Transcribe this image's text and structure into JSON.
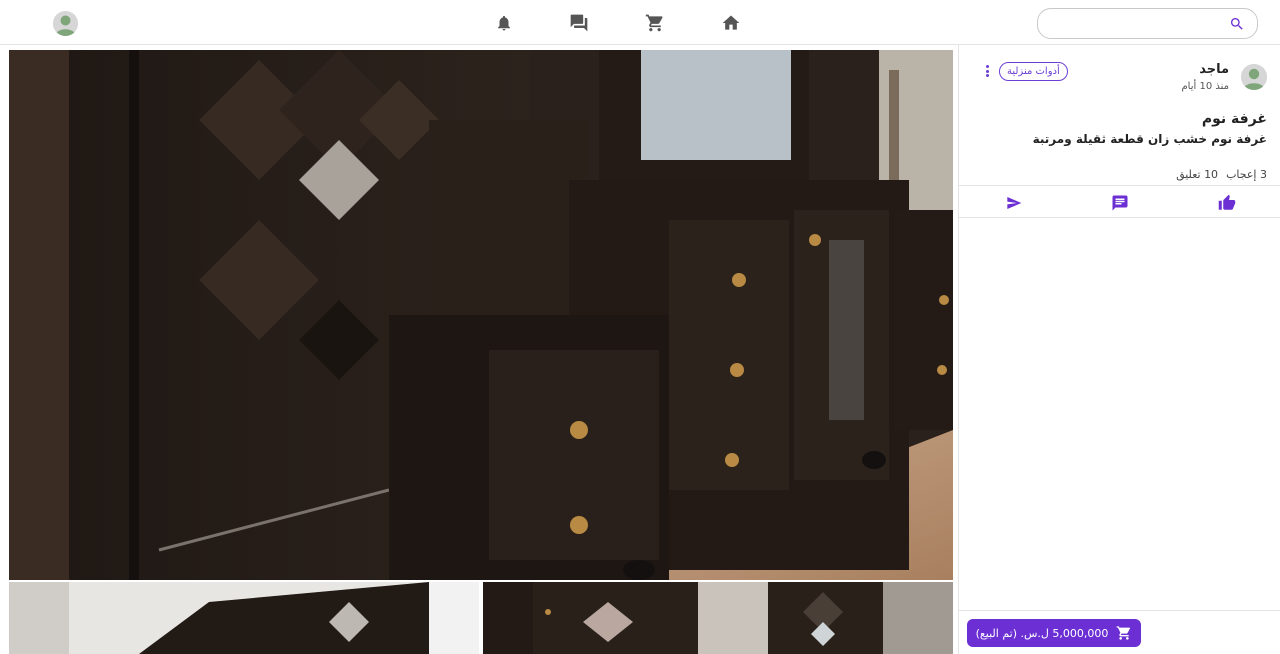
{
  "search": {
    "placeholder": "",
    "value": ""
  },
  "nav": {
    "icons": [
      "home-icon",
      "cart-icon",
      "chat-icon",
      "bell-icon",
      "avatar"
    ]
  },
  "post": {
    "author": "ماجد",
    "time": "منذ 10 أيام",
    "category": "أدوات منزلية",
    "title": "غرفة نوم",
    "description": "غرفة نوم خشب زان قطعة ثقيلة ومرتبة",
    "likes_label": "3 إعجاب",
    "comments_label": "10 تعليق",
    "price_label": "5,000,000 ل.س. (تم البيع)"
  },
  "colors": {
    "accent": "#6b2fd4",
    "nav_icon": "#555555"
  }
}
